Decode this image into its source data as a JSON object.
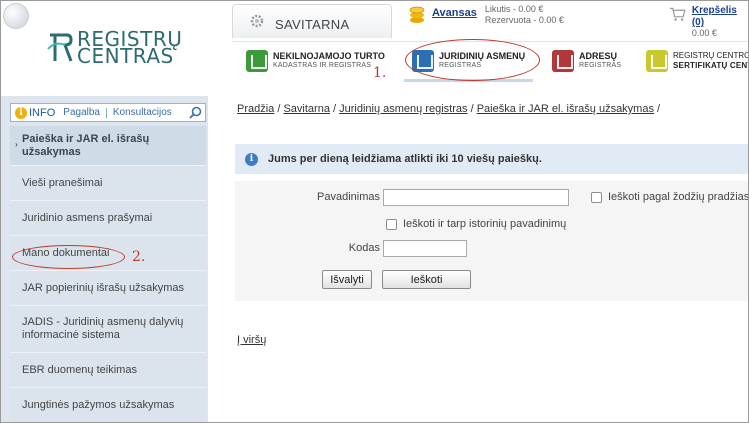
{
  "logo": {
    "line1": "REGISTRŲ",
    "line2": "CENTRAS"
  },
  "header": {
    "savitarna_label": "SAVITARNA",
    "account": {
      "avansas_label": "Avansas",
      "likutis": "Likutis - 0.00 €",
      "rezervuota": "Rezervuota - 0.00 €"
    },
    "cart": {
      "label": "Krepšelis (0)",
      "total": "0.00 €"
    },
    "nav": [
      {
        "title": "NEKILNOJAMOJO TURTO",
        "sub": "KADASTRAS IR REGISTRAS",
        "color": "#3d9a3a"
      },
      {
        "title": "JURIDINIŲ ASMENŲ",
        "sub": "REGISTRAS",
        "color": "#2e6fb3"
      },
      {
        "title": "ADRESŲ",
        "sub": "REGISTRAS",
        "color": "#b0383a"
      },
      {
        "title": "REGISTRŲ CENTRO",
        "sub": "SERTIFIKATŲ CENT",
        "color": "#c9c82e"
      }
    ]
  },
  "annotations": {
    "one": "1.",
    "two": "2."
  },
  "sidebar": {
    "info": {
      "word": "INFO",
      "pagalba": "Pagalba",
      "konsultacijos": "Konsultacijos"
    },
    "items": [
      {
        "label": "Paieška ir JAR el. išrašų užsakymas"
      },
      {
        "label": "Vieši pranešimai"
      },
      {
        "label": "Juridinio asmens prašymai"
      },
      {
        "label": "Mano dokumentai"
      },
      {
        "label": "JAR popierinių išrašų užsakymas"
      },
      {
        "label": "JADIS - Juridinių asmenų dalyvių informacinė sistema"
      },
      {
        "label": "EBR duomenų teikimas"
      },
      {
        "label": "Jungtinės pažymos užsakymas"
      }
    ]
  },
  "breadcrumb": {
    "items": [
      "Pradžia",
      "Savitarna",
      "Juridinių asmenų registras",
      "Paieška ir JAR el. išrašų užsakymas"
    ],
    "separator": " / "
  },
  "alert": {
    "text": "Jums per dieną leidžiama atlikti iki 10 viešų paieškų."
  },
  "form": {
    "name_label": "Pavadinimas",
    "name_value": "",
    "word_start_label": "Ieškoti pagal žodžių pradžias",
    "history_label": "Ieškoti ir tarp istorinių pavadinimų",
    "code_label": "Kodas",
    "code_value": "",
    "clear_button": "Išvalyti",
    "search_button": "Ieškoti"
  },
  "footer": {
    "to_top": "Į viršų"
  }
}
